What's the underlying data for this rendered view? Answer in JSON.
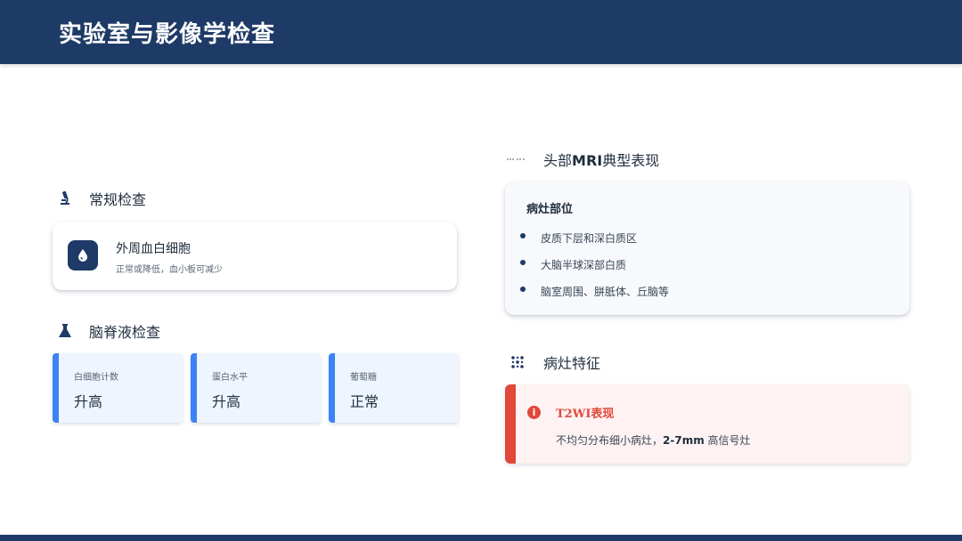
{
  "header": {
    "title": "实验室与影像学检查"
  },
  "routine": {
    "title": "常规检查",
    "icon": "microscope-icon",
    "card": {
      "icon": "drop-icon",
      "title": "外周血白细胞",
      "desc": "正常或降低，血小板可减少"
    }
  },
  "csf": {
    "title": "脑脊液检查",
    "icon": "flask-icon",
    "items": [
      {
        "label": "白细胞计数",
        "value": "升高"
      },
      {
        "label": "蛋白水平",
        "value": "升高"
      },
      {
        "label": "葡萄糖",
        "value": "正常"
      }
    ]
  },
  "mri": {
    "title_prefix": "头部",
    "title_bold": "MRI",
    "title_suffix": "典型表现",
    "icon": "brain-scan-icon",
    "card": {
      "title": "病灶部位",
      "items": [
        "皮质下层和深白质区",
        "大脑半球深部白质",
        "脑室周围、胼胝体、丘脑等"
      ]
    }
  },
  "lesion": {
    "title": "病灶特征",
    "icon": "dots-grid-icon",
    "card": {
      "icon": "info-icon",
      "title": "T2WI表现",
      "desc_pre": "不均匀分布细小病灶，",
      "desc_bold": "2-7mm",
      "desc_post": " 高信号灶"
    }
  },
  "colors": {
    "primary": "#1e3a66",
    "accent": "#3b82f6",
    "alert": "#e0483a"
  }
}
